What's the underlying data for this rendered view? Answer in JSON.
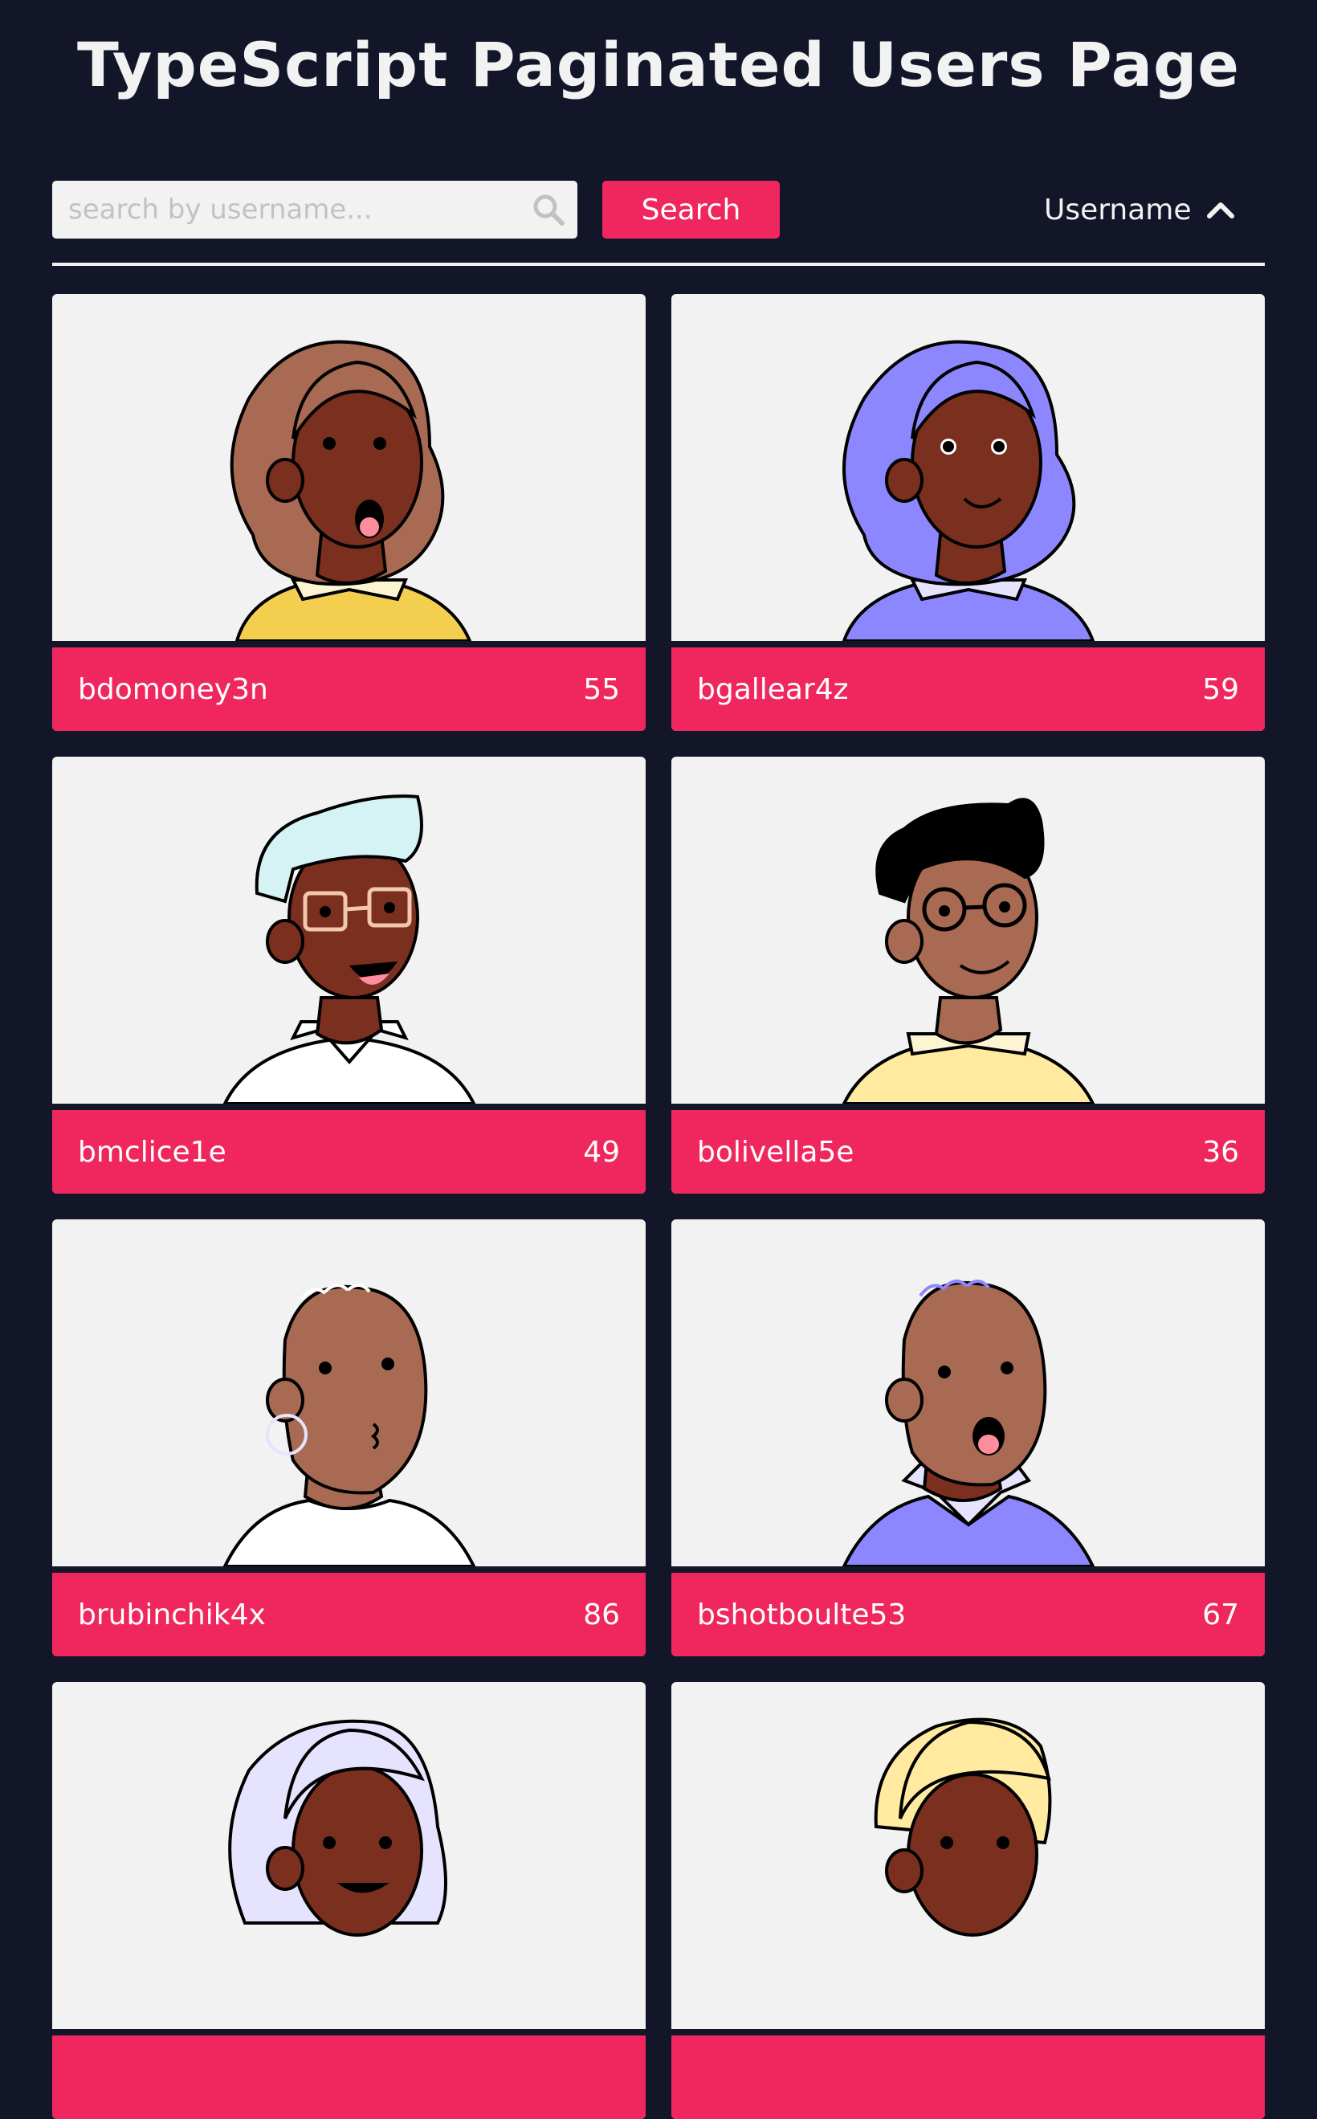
{
  "header": {
    "title": "TypeScript Paginated Users Page"
  },
  "search": {
    "placeholder": "search by username...",
    "value": "",
    "button_label": "Search"
  },
  "sort": {
    "label": "Username",
    "direction": "ascending"
  },
  "colors": {
    "background": "#131628",
    "accent": "#f0265f",
    "card": "#f2f2f2"
  },
  "users": [
    {
      "username": "bdomoney3n",
      "count": "55"
    },
    {
      "username": "bgallear4z",
      "count": "59"
    },
    {
      "username": "bmclice1e",
      "count": "49"
    },
    {
      "username": "bolivella5e",
      "count": "36"
    },
    {
      "username": "brubinchik4x",
      "count": "86"
    },
    {
      "username": "bshotboulte53",
      "count": "67"
    },
    {
      "username": "",
      "count": ""
    },
    {
      "username": "",
      "count": ""
    }
  ]
}
